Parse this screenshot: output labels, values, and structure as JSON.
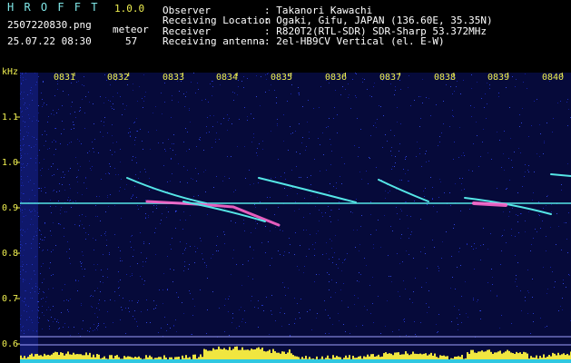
{
  "app": {
    "title": "H R O F F T",
    "version": "1.0.0"
  },
  "file": {
    "name": "2507220830.png",
    "timestamp": "25.07.22 08:30"
  },
  "meteor": {
    "label": "meteor",
    "count": "57"
  },
  "info": {
    "labels": [
      "Observer",
      "Receiving Location",
      "Receiver",
      "Receiving antenna"
    ],
    "values": [
      ": Takanori Kawachi",
      ": Ogaki, Gifu, JAPAN (136.60E, 35.35N)",
      ": R820T2(RTL-SDR) SDR-Sharp 53.372MHz",
      ": 2el-HB9CV Vertical (el. E-W)"
    ]
  },
  "axes": {
    "y_unit": "kHz",
    "y_ticks": [
      "1.1",
      "1.0",
      "0.9",
      "0.8",
      "0.7",
      "0.6"
    ],
    "x_ticks": [
      "0831",
      "0832",
      "0833",
      "0834",
      "0835",
      "0836",
      "0837",
      "0838",
      "0839",
      "0840"
    ]
  },
  "colors": {
    "header_text": "#7fe6e6",
    "axis_text": "#f0f050",
    "background": "#000000",
    "noise": "#1a2aa8"
  }
}
